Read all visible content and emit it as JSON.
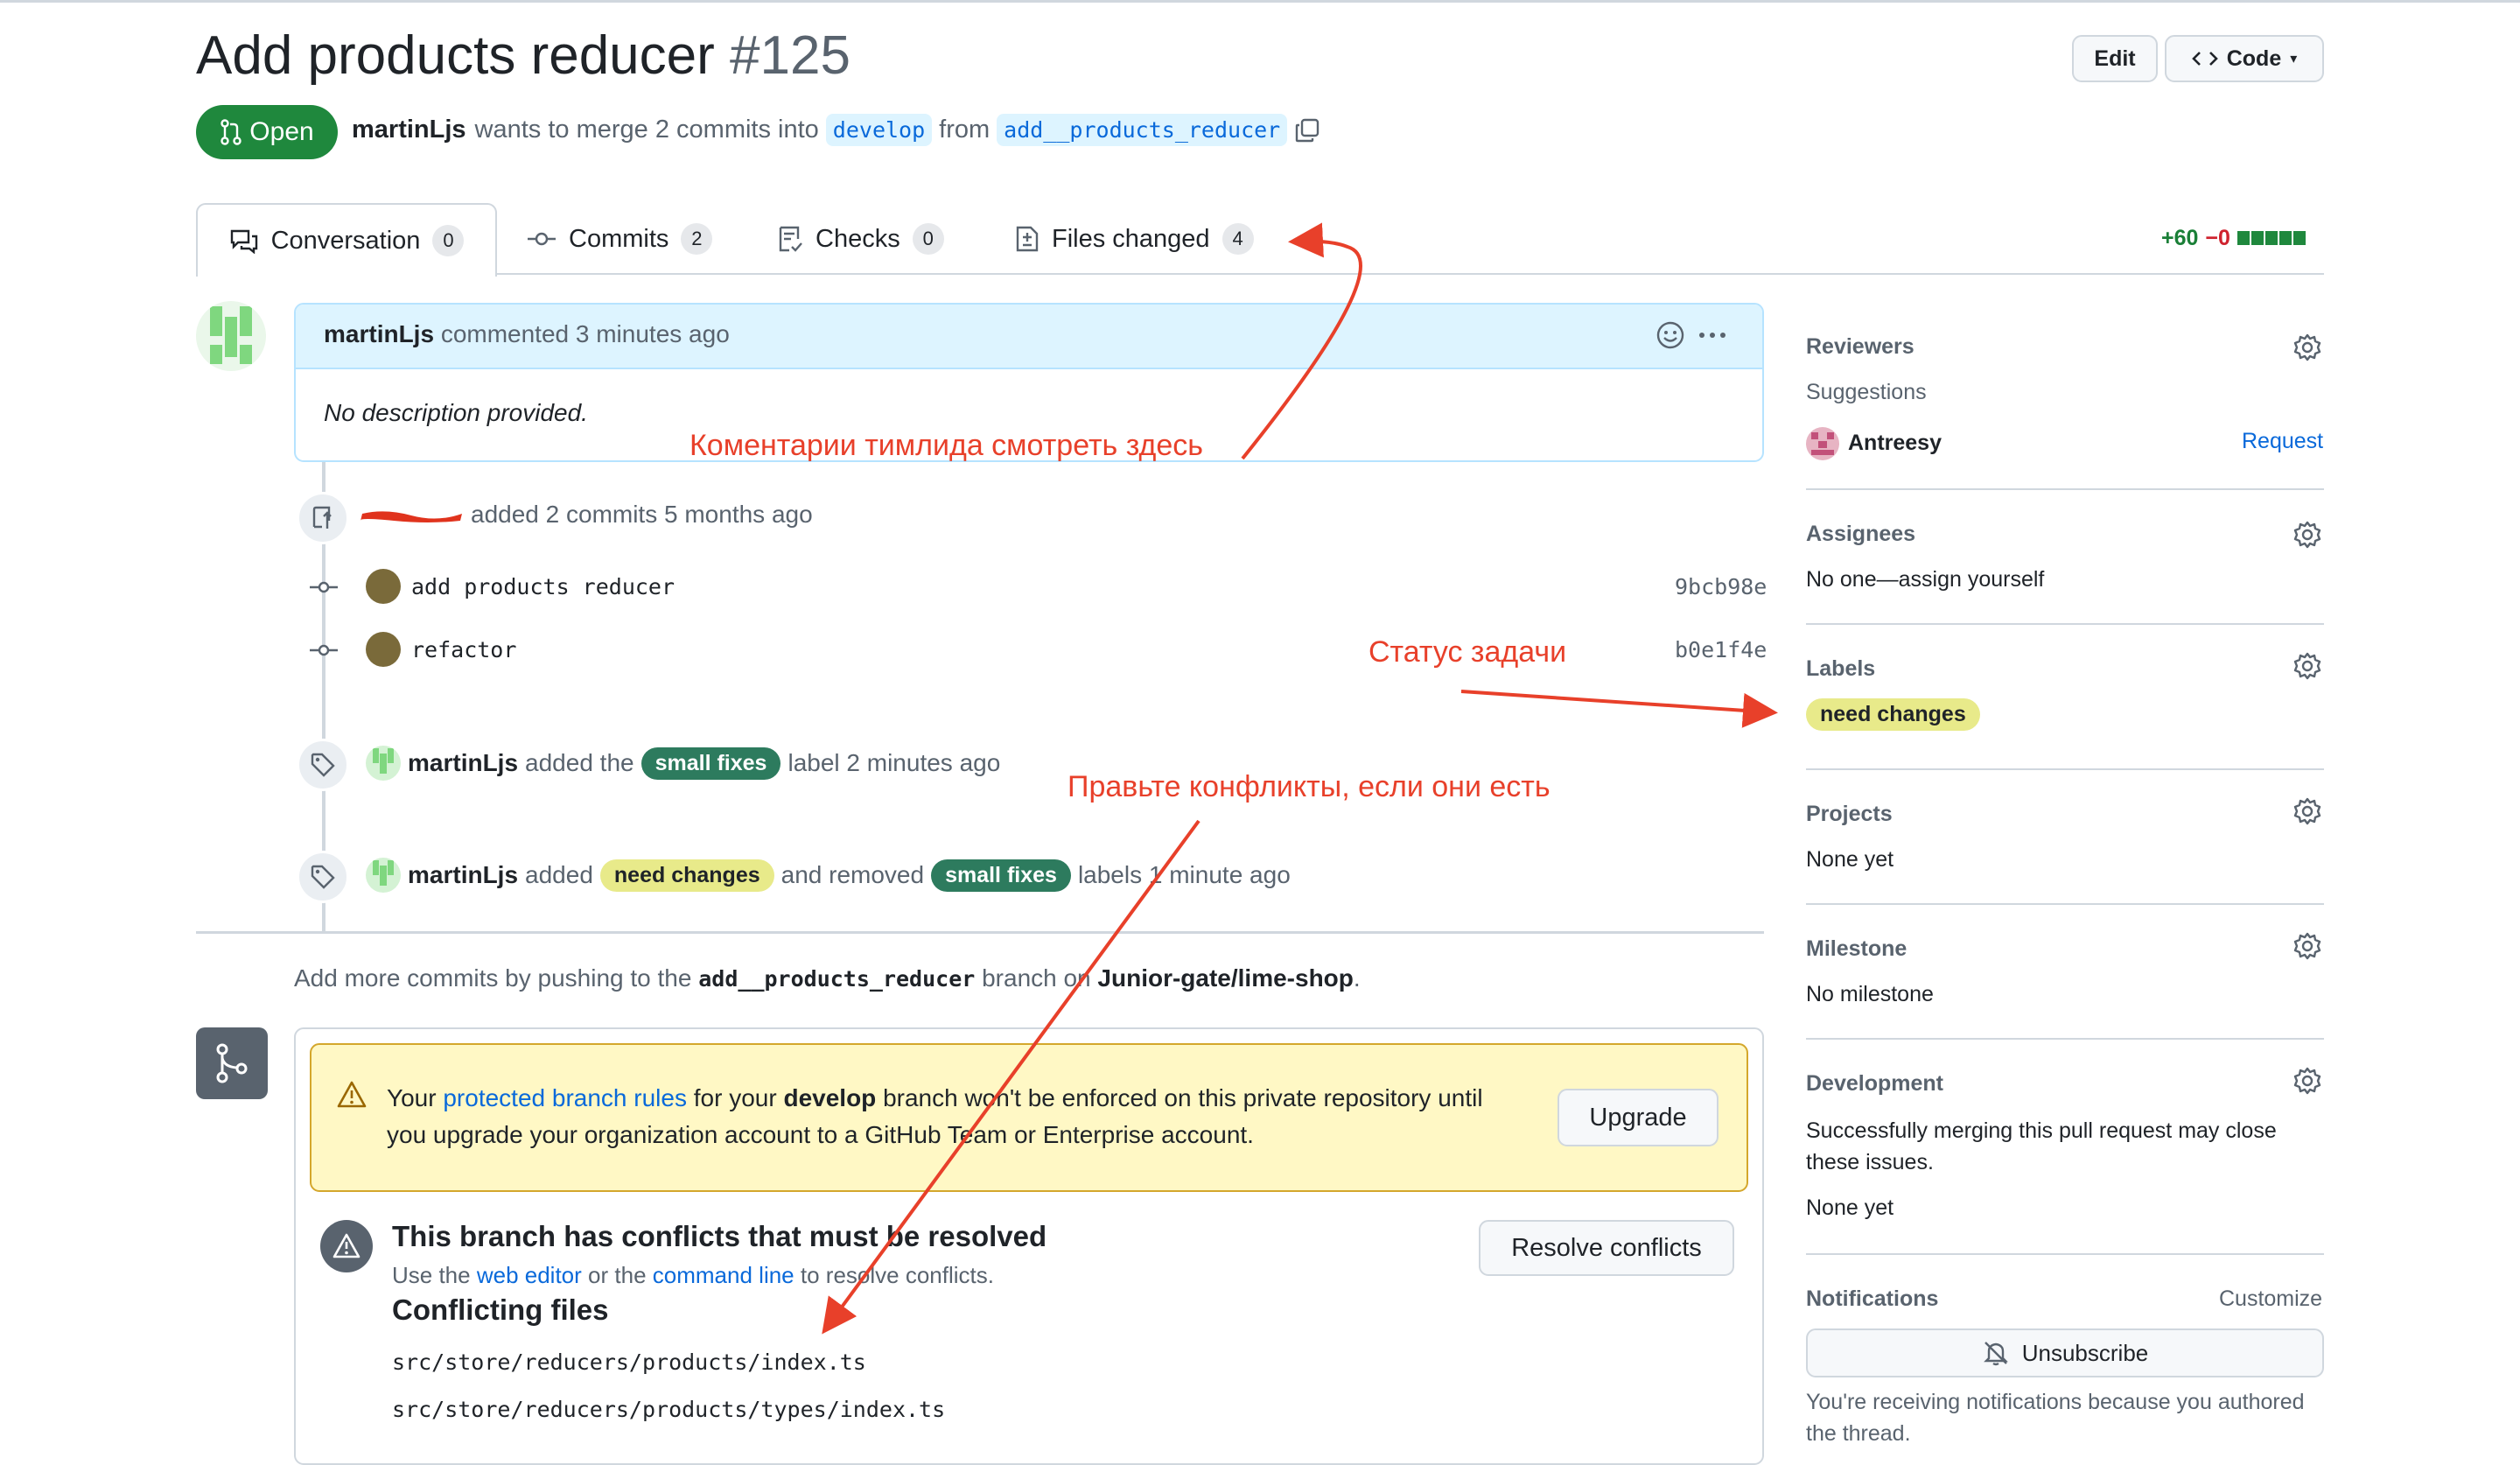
{
  "pr": {
    "title": "Add products reducer",
    "number": "#125",
    "state": "Open",
    "author": "martinLjs",
    "merge_text": "wants to merge 2 commits into",
    "base_branch": "develop",
    "from_word": "from",
    "head_branch": "add__products_reducer"
  },
  "header_buttons": {
    "edit": "Edit",
    "code": "Code"
  },
  "tabs": [
    {
      "label": "Conversation",
      "count": "0"
    },
    {
      "label": "Commits",
      "count": "2"
    },
    {
      "label": "Checks",
      "count": "0"
    },
    {
      "label": "Files changed",
      "count": "4"
    }
  ],
  "diffstat": {
    "additions": "+60",
    "deletions": "−0"
  },
  "comment": {
    "author": "martinLjs",
    "action": "commented 3 minutes ago",
    "body": "No description provided."
  },
  "commit_event": {
    "text": "added 2 commits 5 months ago"
  },
  "commits": [
    {
      "message": "add products reducer",
      "sha": "9bcb98e"
    },
    {
      "message": "refactor",
      "sha": "b0e1f4e"
    }
  ],
  "label_event_1": {
    "author": "martinLjs",
    "before": "added the",
    "label": "small fixes",
    "after": "label 2 minutes ago"
  },
  "label_event_2": {
    "author": "martinLjs",
    "before": "added",
    "label_added": "need changes",
    "middle": "and removed",
    "label_removed": "small fixes",
    "after": "labels 1 minute ago"
  },
  "push_hint": {
    "before": "Add more commits by pushing to the",
    "branch": "add__products_reducer",
    "middle": "branch on",
    "repo": "Junior-gate/lime-shop",
    "end": "."
  },
  "warning": {
    "t1": "Your",
    "link": "protected branch rules",
    "t2": "for your",
    "branch": "develop",
    "t3": "branch won't be enforced on this private repository until you upgrade your organization account to a GitHub Team or Enterprise account.",
    "button": "Upgrade"
  },
  "conflicts": {
    "title": "This branch has conflicts that must be resolved",
    "sub1": "Use the",
    "link1": "web editor",
    "sub2": "or the",
    "link2": "command line",
    "sub3": "to resolve conflicts.",
    "button": "Resolve conflicts",
    "files_title": "Conflicting files",
    "files": [
      "src/store/reducers/products/index.ts",
      "src/store/reducers/products/types/index.ts"
    ]
  },
  "sidebar": {
    "reviewers": {
      "title": "Reviewers",
      "suggestions": "Suggestions",
      "user": "Antreesy",
      "request": "Request"
    },
    "assignees": {
      "title": "Assignees",
      "value": "No one—assign yourself"
    },
    "labels": {
      "title": "Labels",
      "label": "need changes"
    },
    "projects": {
      "title": "Projects",
      "value": "None yet"
    },
    "milestone": {
      "title": "Milestone",
      "value": "No milestone"
    },
    "development": {
      "title": "Development",
      "text": "Successfully merging this pull request may close these issues.",
      "value": "None yet"
    },
    "notifications": {
      "title": "Notifications",
      "customize": "Customize",
      "button": "Unsubscribe",
      "reason": "You're receiving notifications because you authored the thread."
    }
  },
  "annotations": {
    "comments": "Коментарии тимлида смотреть здесь",
    "status": "Статус задачи",
    "conflicts": "Правьте конфликты, если они есть"
  },
  "colors": {
    "open_green": "#1f883d",
    "link_blue": "#0969da",
    "annotation_red": "#e8402a",
    "label_green": "#2d7b5e",
    "label_yellow": "#e8ea8a"
  }
}
